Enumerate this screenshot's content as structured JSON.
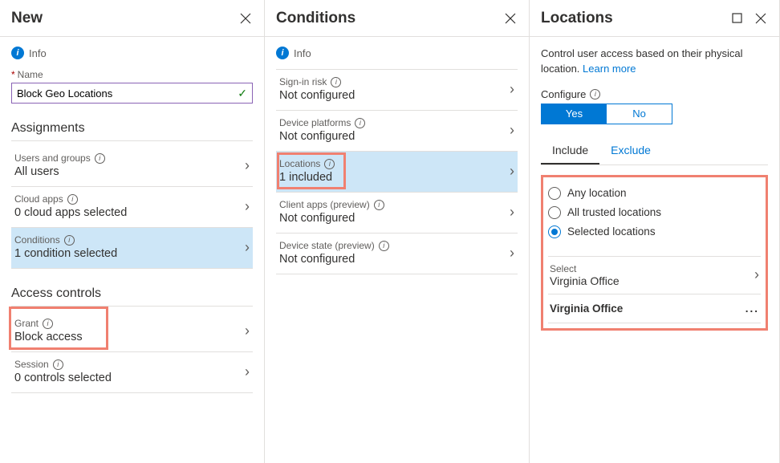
{
  "panel1": {
    "title": "New",
    "info": "Info",
    "name_label": "Name",
    "name_value": "Block Geo Locations",
    "assignments_title": "Assignments",
    "users_label": "Users and groups",
    "users_value": "All users",
    "cloud_label": "Cloud apps",
    "cloud_value": "0 cloud apps selected",
    "conditions_label": "Conditions",
    "conditions_value": "1 condition selected",
    "access_title": "Access controls",
    "grant_label": "Grant",
    "grant_value": "Block access",
    "session_label": "Session",
    "session_value": "0 controls selected"
  },
  "panel2": {
    "title": "Conditions",
    "info": "Info",
    "signin_label": "Sign-in risk",
    "signin_value": "Not configured",
    "device_label": "Device platforms",
    "device_value": "Not configured",
    "locations_label": "Locations",
    "locations_value": "1 included",
    "client_label": "Client apps (preview)",
    "client_value": "Not configured",
    "state_label": "Device state (preview)",
    "state_value": "Not configured"
  },
  "panel3": {
    "title": "Locations",
    "desc": "Control user access based on their physical location.",
    "learn_more": "Learn more",
    "configure_label": "Configure",
    "yes": "Yes",
    "no": "No",
    "tab_include": "Include",
    "tab_exclude": "Exclude",
    "opt_any": "Any location",
    "opt_trusted": "All trusted locations",
    "opt_selected": "Selected locations",
    "select_label": "Select",
    "select_value": "Virginia Office",
    "location_entry": "Virginia Office"
  }
}
